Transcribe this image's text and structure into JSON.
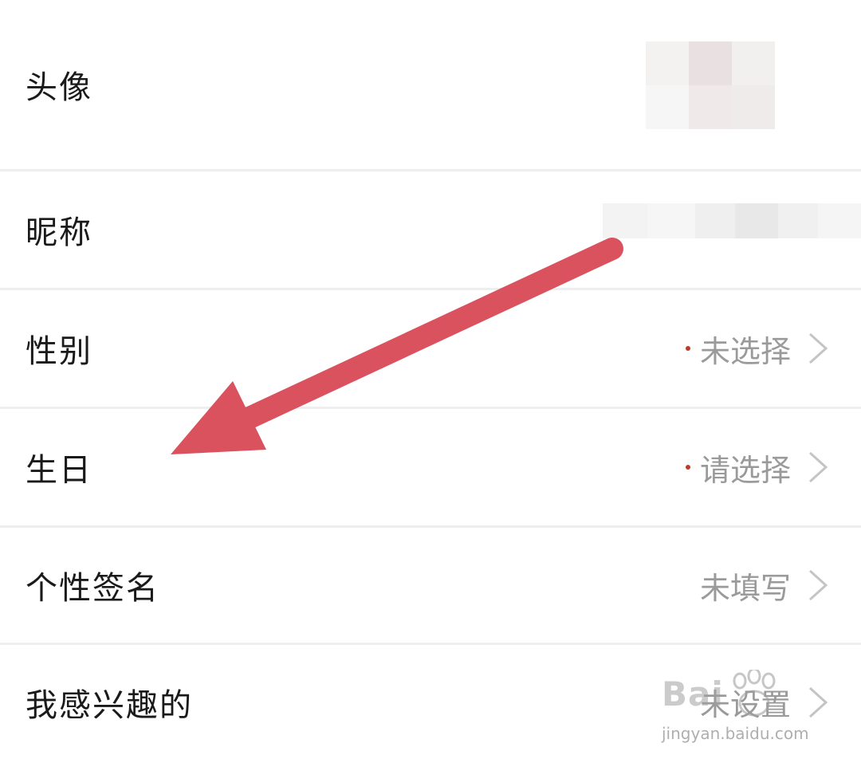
{
  "profile": {
    "rows": [
      {
        "label": "头像",
        "value": "",
        "required": false
      },
      {
        "label": "昵称",
        "value": "",
        "required": false
      },
      {
        "label": "性别",
        "value": "未选择",
        "required": true
      },
      {
        "label": "生日",
        "value": "请选择",
        "required": true
      },
      {
        "label": "个性签名",
        "value": "未填写",
        "required": false
      },
      {
        "label": "我感兴趣的",
        "value": "未设置",
        "required": false
      }
    ]
  },
  "annotation": {
    "arrow_color": "#d9525e"
  },
  "watermark": {
    "brand": "Bai",
    "site": "jingyan.baidu.com"
  },
  "colors": {
    "label": "#1a1a1a",
    "value": "#9a9a9a",
    "required_dot": "#c0392b",
    "divider": "#eeeeee"
  }
}
